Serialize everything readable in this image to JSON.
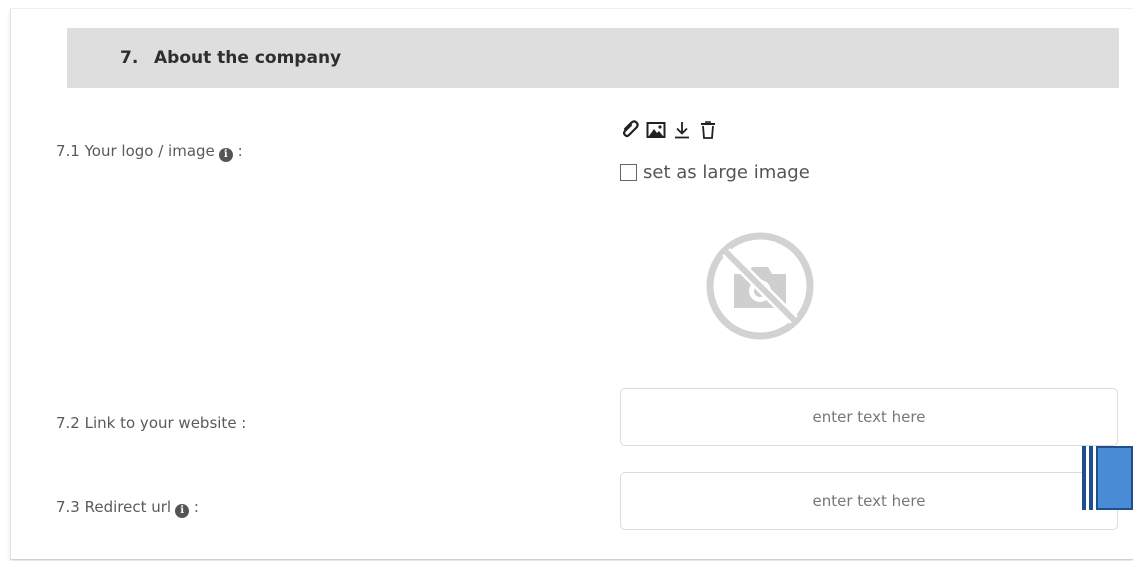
{
  "section": {
    "number": "7.",
    "title": "About the company"
  },
  "fields": {
    "logo": {
      "label": "7.1 Your logo / image",
      "suffix": ":"
    },
    "website": {
      "label": "7.2 Link to your website :",
      "placeholder": "enter text here"
    },
    "redirect": {
      "label": "7.3 Redirect url",
      "suffix": ":",
      "placeholder": "enter text here"
    }
  },
  "image_tools": {
    "icons": [
      "paperclip-icon",
      "image-icon",
      "download-icon",
      "trash-icon"
    ]
  },
  "large_image_option": {
    "label": "set as large image",
    "checked": false
  },
  "info_glyph": "i",
  "colors": {
    "header_bg": "#dedede",
    "text": "#555555",
    "handle_blue": "#4a8bd6",
    "handle_dark": "#1f4f8f"
  }
}
